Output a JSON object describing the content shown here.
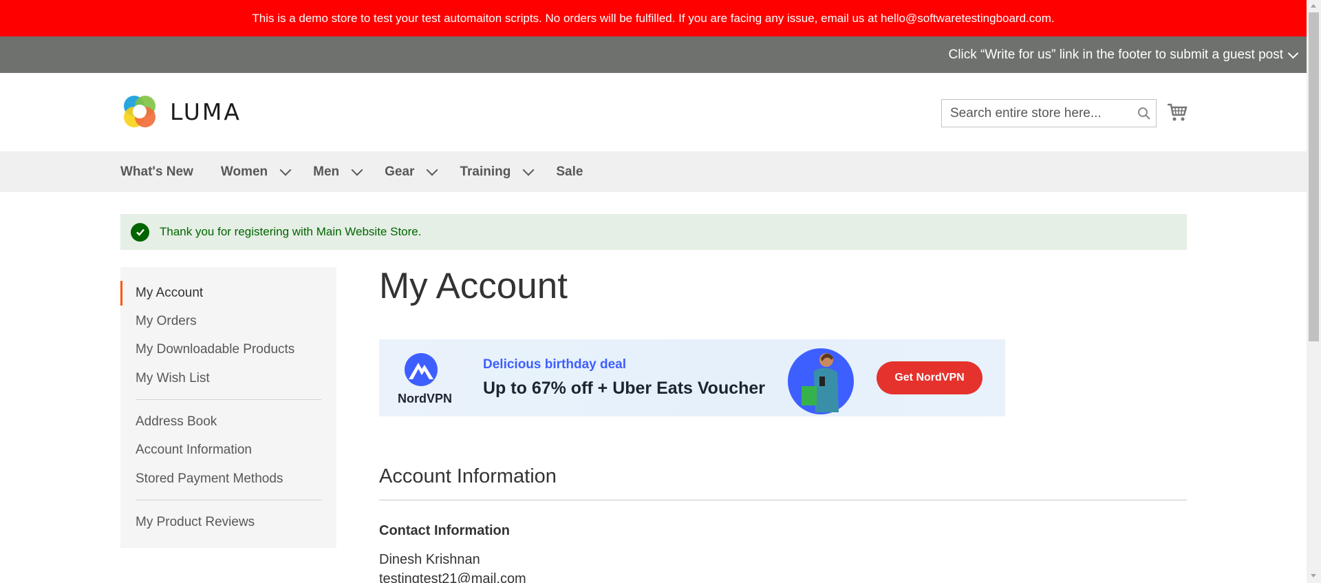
{
  "demo_notice": "This is a demo store to test your test automaiton scripts. No orders will be fulfilled. If you are facing any issue, email us at hello@softwaretestingboard.com.",
  "guest_notice": "Click “Write for us” link in the footer to submit a guest post",
  "header": {
    "logo_text": "LUMA",
    "search_placeholder": "Search entire store here..."
  },
  "nav": {
    "items": [
      {
        "label": "What's New"
      },
      {
        "label": "Women"
      },
      {
        "label": "Men"
      },
      {
        "label": "Gear"
      },
      {
        "label": "Training"
      },
      {
        "label": "Sale"
      }
    ]
  },
  "message": "Thank you for registering with Main Website Store.",
  "sidebar": {
    "items": [
      {
        "label": "My Account"
      },
      {
        "label": "My Orders"
      },
      {
        "label": "My Downloadable Products"
      },
      {
        "label": "My Wish List"
      },
      {
        "label": "Address Book"
      },
      {
        "label": "Account Information"
      },
      {
        "label": "Stored Payment Methods"
      },
      {
        "label": "My Product Reviews"
      }
    ]
  },
  "main": {
    "title": "My Account",
    "ad": {
      "brand": "NordVPN",
      "subhead": "Delicious birthday deal",
      "headline": "Up to 67% off + Uber Eats Voucher",
      "button": "Get NordVPN"
    },
    "section_title": "Account Information",
    "contact_heading": "Contact Information",
    "contact_name": "Dinesh Krishnan",
    "contact_email": "testingtest21@mail.com"
  },
  "colors": {
    "demo_bar": "#ff0000",
    "guest_bar": "#6e716e",
    "nav_bg": "#f0f0f0",
    "active_accent": "#ff5501",
    "success_bg": "#e5efe5",
    "success_text": "#006400",
    "ad_button": "#e5322d"
  }
}
